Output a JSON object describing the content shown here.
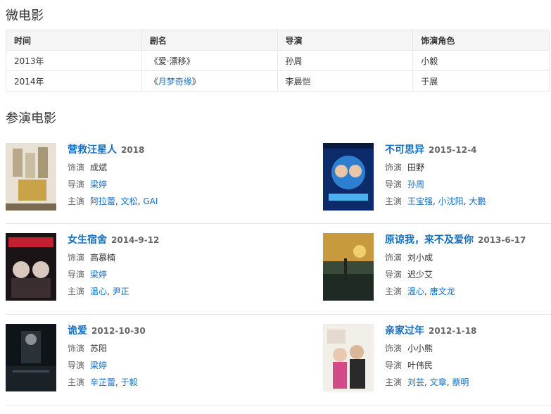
{
  "micro": {
    "title": "微电影",
    "headers": [
      "时间",
      "剧名",
      "导演",
      "饰演角色"
    ],
    "rows": [
      {
        "year": "2013年",
        "name": "爱·漂移",
        "director": "孙周",
        "role": "小毅",
        "linked": false
      },
      {
        "year": "2014年",
        "name": "月梦奇缘",
        "director": "李晨恺",
        "role": "于展",
        "linked": true
      }
    ]
  },
  "films": {
    "title": "参演电影",
    "labels": {
      "role": "饰演",
      "director": "导演",
      "cast": "主演"
    },
    "items": [
      {
        "title": "营救汪星人",
        "date": "2018",
        "role": "成斌",
        "director": "梁婷",
        "cast": [
          "阿拉蕾",
          "文松",
          "GAI"
        ]
      },
      {
        "title": "不可思异",
        "date": "2015-12-4",
        "role": "田野",
        "director": "孙周",
        "cast": [
          "王宝强",
          "小沈阳",
          "大鹏"
        ]
      },
      {
        "title": "女生宿舍",
        "date": "2014-9-12",
        "role": "高慕楠",
        "director": "梁婷",
        "cast": [
          "温心",
          "尹正"
        ]
      },
      {
        "title": "原谅我，来不及爱你",
        "date": "2013-6-17",
        "role": "刘小成",
        "director": "迟少艾",
        "cast": [
          "温心",
          "唐文龙"
        ]
      },
      {
        "title": "诡爱",
        "date": "2012-10-30",
        "role": "苏阳",
        "director": "梁婷",
        "cast": [
          "辛芷蕾",
          "于毅"
        ]
      },
      {
        "title": "亲家过年",
        "date": "2012-1-18",
        "role": "小小熊",
        "director": "叶伟民",
        "cast": [
          "刘芸",
          "文章",
          "蔡明"
        ]
      }
    ],
    "director_linked": [
      true,
      true,
      true,
      false,
      true,
      false
    ]
  },
  "colors": {
    "link": "#136ec2",
    "border": "#e6e6e6",
    "header_bg": "#f5f5f5"
  }
}
